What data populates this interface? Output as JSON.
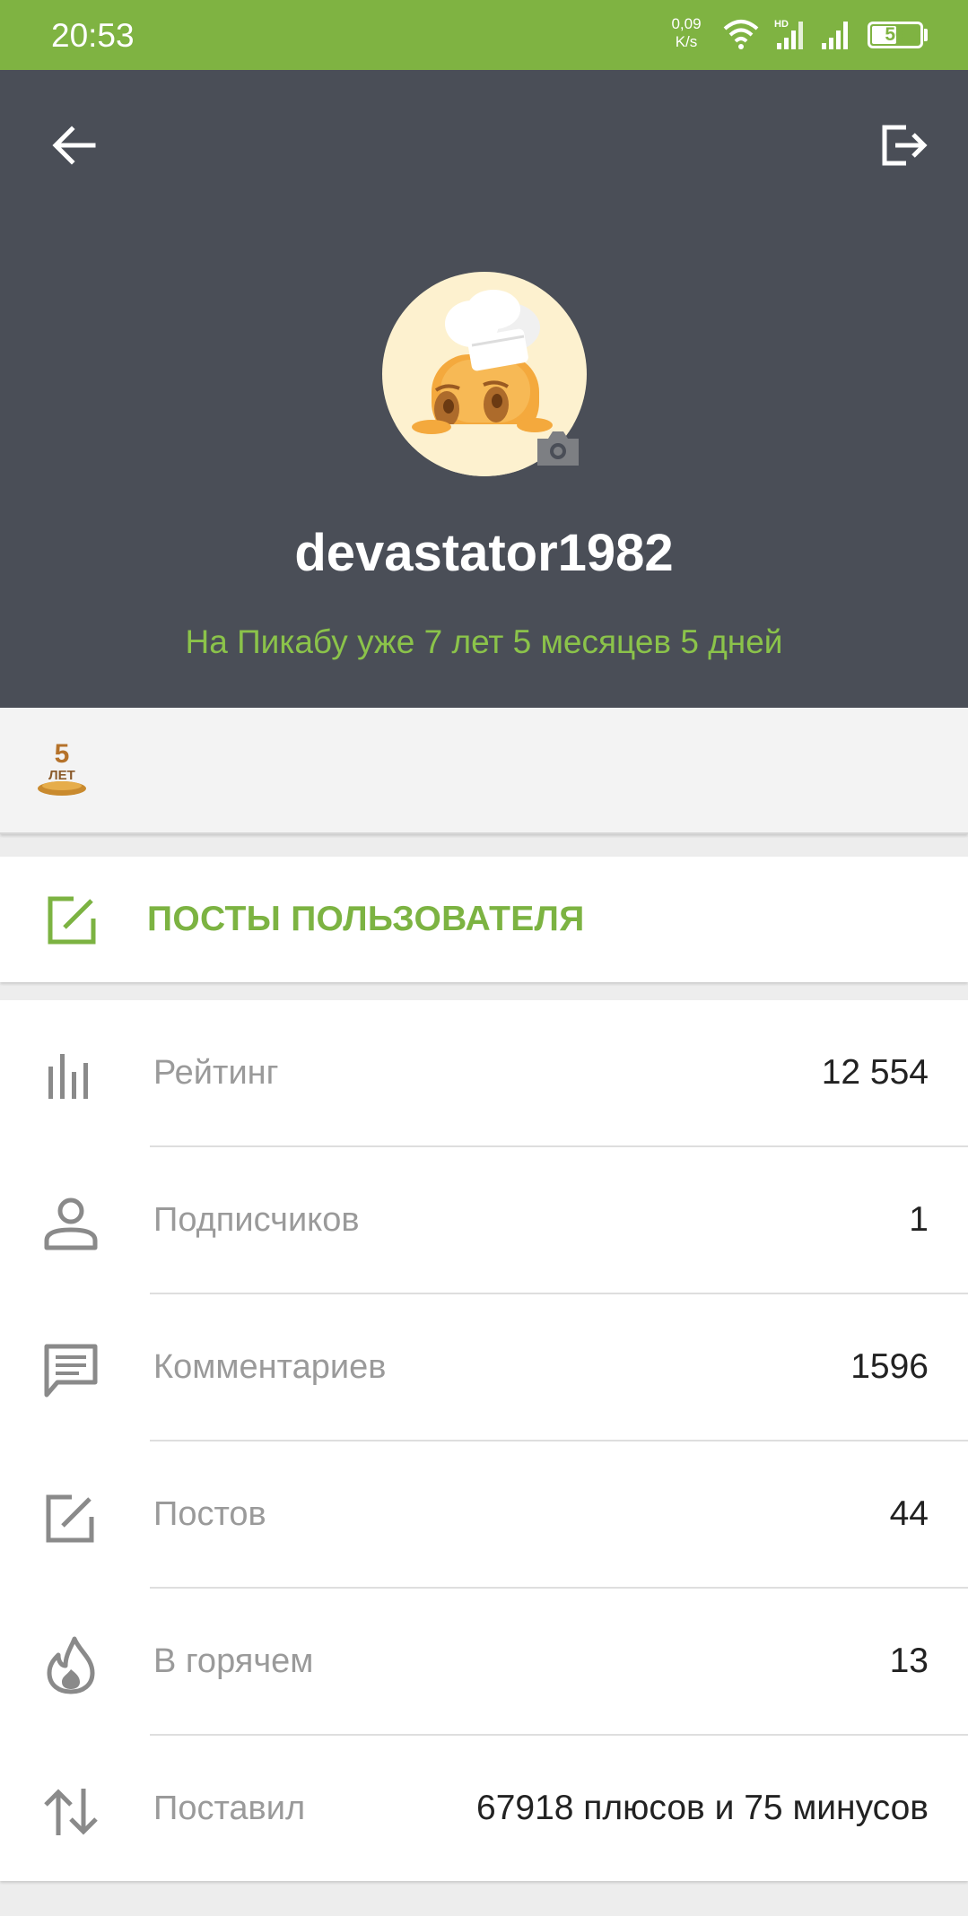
{
  "status_bar": {
    "time": "20:53",
    "net_speed_value": "0,09",
    "net_speed_unit": "K/s",
    "battery": "56",
    "battery_level": 0.56
  },
  "header": {
    "username": "devastator1982",
    "member_since": "На Пикабу уже 7 лет 5 месяцев 5 дней"
  },
  "award": {
    "number": "5",
    "text": "ЛЕТ"
  },
  "posts_button": {
    "label": "ПОСТЫ ПОЛЬЗОВАТЕЛЯ"
  },
  "stats": [
    {
      "icon": "bar-chart-icon",
      "label": "Рейтинг",
      "value": "12 554"
    },
    {
      "icon": "person-icon",
      "label": "Подписчиков",
      "value": "1"
    },
    {
      "icon": "comment-icon",
      "label": "Комментариев",
      "value": "1596"
    },
    {
      "icon": "edit-icon",
      "label": "Постов",
      "value": "44"
    },
    {
      "icon": "flame-icon",
      "label": "В горячем",
      "value": "13"
    },
    {
      "icon": "swap-vertical-icon",
      "label": "Поставил",
      "value": "67918 плюсов и 75 минусов"
    }
  ],
  "colors": {
    "status_bar": "#7fb342",
    "header_bg": "#4a4e57",
    "accent_green": "#7cb342"
  }
}
